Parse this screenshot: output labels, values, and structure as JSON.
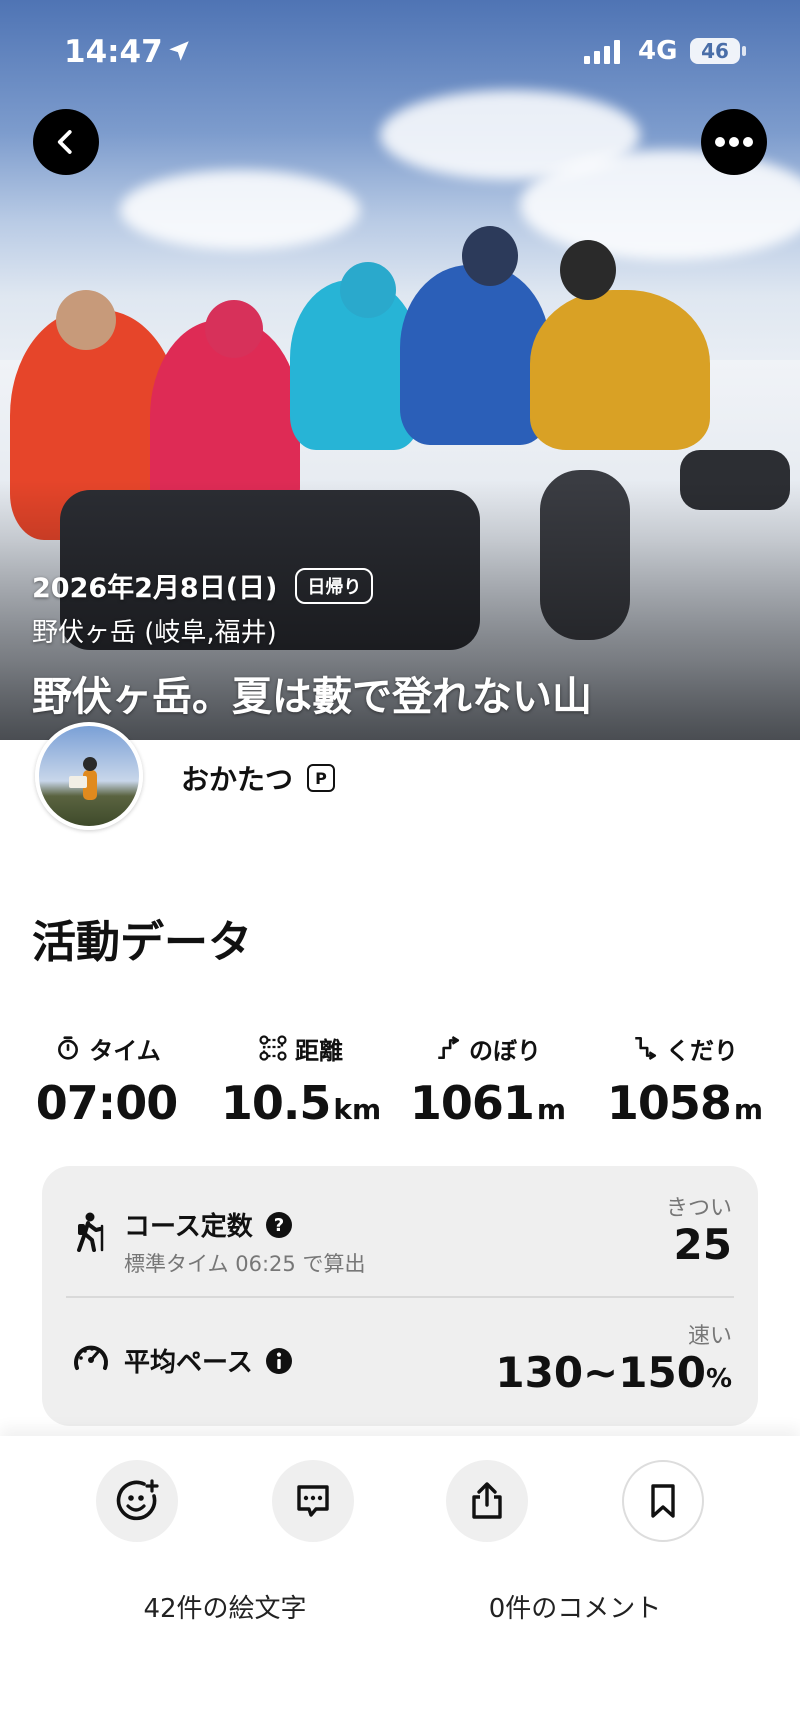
{
  "status_bar": {
    "time": "14:47",
    "network": "4G",
    "battery": "46"
  },
  "hero": {
    "date": "2026年2月8日(日)",
    "tag": "日帰り",
    "location": "野伏ヶ岳 (岐阜,福井)",
    "title": "野伏ヶ岳。夏は藪で登れない山"
  },
  "profile": {
    "username": "おかたつ",
    "badge": "P"
  },
  "activity": {
    "section_title": "活動データ",
    "stats": [
      {
        "label": "タイム",
        "value": "07:00",
        "unit": ""
      },
      {
        "label": "距離",
        "value": "10.5",
        "unit": "km"
      },
      {
        "label": "のぼり",
        "value": "1061",
        "unit": "m"
      },
      {
        "label": "くだり",
        "value": "1058",
        "unit": "m"
      }
    ],
    "course_constant": {
      "label": "コース定数",
      "sub": "標準タイム 06:25 で算出",
      "rating": "きつい",
      "value": "25"
    },
    "average_pace": {
      "label": "平均ペース",
      "rating": "速い",
      "value": "130~150",
      "unit": "%"
    }
  },
  "bottom": {
    "emoji_count": "42件の絵文字",
    "comment_count": "0件のコメント"
  }
}
